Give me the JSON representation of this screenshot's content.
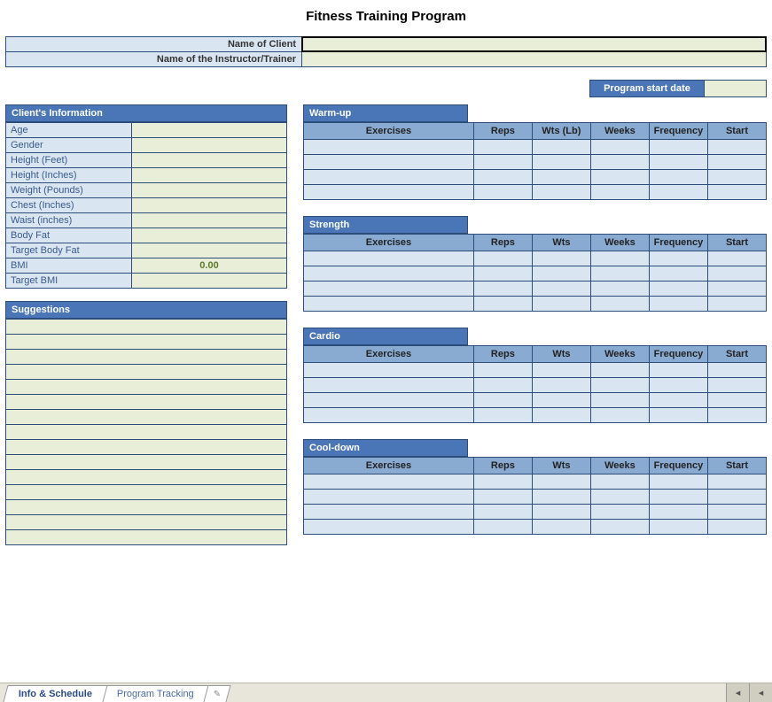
{
  "title": "Fitness Training Program",
  "header": {
    "client_label": "Name of Client",
    "client_value": "",
    "trainer_label": "Name of the Instructor/Trainer",
    "trainer_value": ""
  },
  "program_start": {
    "label": "Program start date",
    "value": ""
  },
  "client_info": {
    "title": "Client's Information",
    "rows": [
      {
        "label": "Age",
        "value": ""
      },
      {
        "label": "Gender",
        "value": ""
      },
      {
        "label": "Height (Feet)",
        "value": ""
      },
      {
        "label": "Height (Inches)",
        "value": ""
      },
      {
        "label": "Weight (Pounds)",
        "value": ""
      },
      {
        "label": "Chest (Inches)",
        "value": ""
      },
      {
        "label": "Waist (inches)",
        "value": ""
      },
      {
        "label": "Body Fat",
        "value": ""
      },
      {
        "label": "Target Body Fat",
        "value": ""
      },
      {
        "label": "BMI",
        "value": "0.00"
      },
      {
        "label": "Target BMI",
        "value": ""
      }
    ]
  },
  "suggestions": {
    "title": "Suggestions",
    "row_count": 15
  },
  "exercise_sections": [
    {
      "title": "Warm-up",
      "columns": [
        "Exercises",
        "Reps",
        "Wts (Lb)",
        "Weeks",
        "Frequency",
        "Start"
      ],
      "row_count": 4
    },
    {
      "title": "Strength",
      "columns": [
        "Exercises",
        "Reps",
        "Wts",
        "Weeks",
        "Frequency",
        "Start"
      ],
      "row_count": 4
    },
    {
      "title": "Cardio",
      "columns": [
        "Exercises",
        "Reps",
        "Wts",
        "Weeks",
        "Frequency",
        "Start"
      ],
      "row_count": 4
    },
    {
      "title": "Cool-down",
      "columns": [
        "Exercises",
        "Reps",
        "Wts",
        "Weeks",
        "Frequency",
        "Start"
      ],
      "row_count": 4
    }
  ],
  "tabs": {
    "active": "Info & Schedule",
    "other": "Program Tracking"
  }
}
